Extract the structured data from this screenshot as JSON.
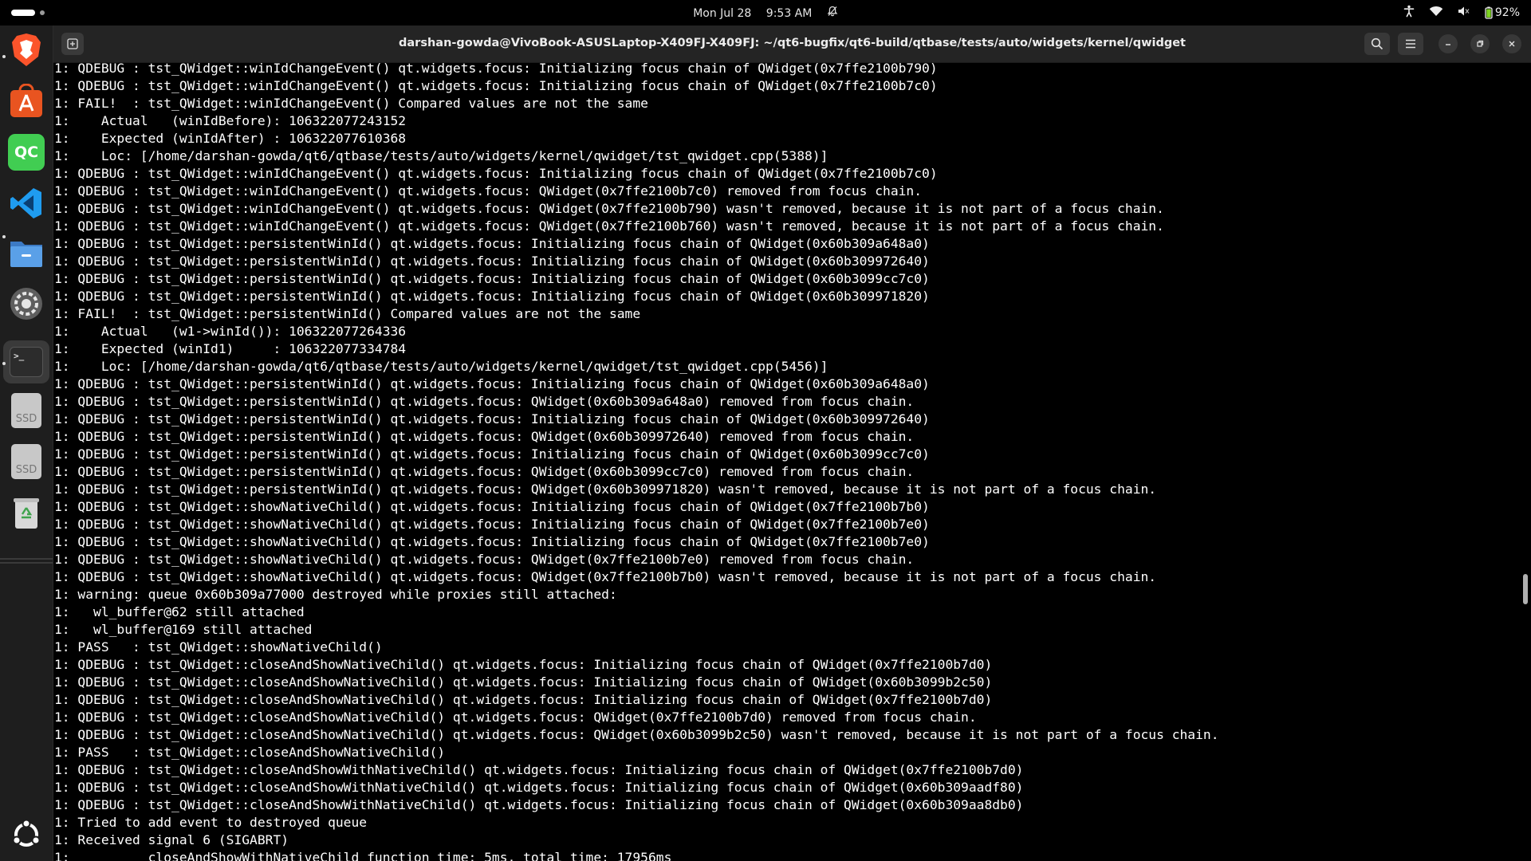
{
  "topbar": {
    "date": "Mon Jul 28",
    "time": "9:53 AM",
    "battery": "92%"
  },
  "dock": {
    "apps": [
      {
        "name": "brave-icon",
        "label": ""
      },
      {
        "name": "app-center-icon",
        "label": ""
      },
      {
        "name": "qt-creator-icon",
        "label": "QC"
      },
      {
        "name": "vscode-icon",
        "label": ""
      },
      {
        "name": "files-icon",
        "label": ""
      },
      {
        "name": "settings-icon",
        "label": ""
      },
      {
        "name": "terminal-icon",
        "label": ">_"
      },
      {
        "name": "ssd-drive-icon",
        "label": "SSD"
      },
      {
        "name": "ssd-drive-icon-2",
        "label": "SSD"
      },
      {
        "name": "trash-icon",
        "label": ""
      }
    ]
  },
  "window": {
    "title": "darshan-gowda@VivoBook-ASUSLaptop-X409FJ-X409FJ: ~/qt6-bugfix/qt6-build/qtbase/tests/auto/widgets/kernel/qwidget"
  },
  "terminal": {
    "lines": [
      "1: QDEBUG : tst_QWidget::winIdChangeEvent() qt.widgets.focus: Initializing focus chain of QWidget(0x7ffe2100b790)",
      "1: QDEBUG : tst_QWidget::winIdChangeEvent() qt.widgets.focus: Initializing focus chain of QWidget(0x7ffe2100b7c0)",
      "1: FAIL!  : tst_QWidget::winIdChangeEvent() Compared values are not the same",
      "1:    Actual   (winIdBefore): 106322077243152",
      "1:    Expected (winIdAfter) : 106322077610368",
      "1:    Loc: [/home/darshan-gowda/qt6/qtbase/tests/auto/widgets/kernel/qwidget/tst_qwidget.cpp(5388)]",
      "1: QDEBUG : tst_QWidget::winIdChangeEvent() qt.widgets.focus: Initializing focus chain of QWidget(0x7ffe2100b7c0)",
      "1: QDEBUG : tst_QWidget::winIdChangeEvent() qt.widgets.focus: QWidget(0x7ffe2100b7c0) removed from focus chain.",
      "1: QDEBUG : tst_QWidget::winIdChangeEvent() qt.widgets.focus: QWidget(0x7ffe2100b790) wasn't removed, because it is not part of a focus chain.",
      "1: QDEBUG : tst_QWidget::winIdChangeEvent() qt.widgets.focus: QWidget(0x7ffe2100b760) wasn't removed, because it is not part of a focus chain.",
      "1: QDEBUG : tst_QWidget::persistentWinId() qt.widgets.focus: Initializing focus chain of QWidget(0x60b309a648a0)",
      "1: QDEBUG : tst_QWidget::persistentWinId() qt.widgets.focus: Initializing focus chain of QWidget(0x60b309972640)",
      "1: QDEBUG : tst_QWidget::persistentWinId() qt.widgets.focus: Initializing focus chain of QWidget(0x60b3099cc7c0)",
      "1: QDEBUG : tst_QWidget::persistentWinId() qt.widgets.focus: Initializing focus chain of QWidget(0x60b309971820)",
      "1: FAIL!  : tst_QWidget::persistentWinId() Compared values are not the same",
      "1:    Actual   (w1->winId()): 106322077264336",
      "1:    Expected (winId1)     : 106322077334784",
      "1:    Loc: [/home/darshan-gowda/qt6/qtbase/tests/auto/widgets/kernel/qwidget/tst_qwidget.cpp(5456)]",
      "1: QDEBUG : tst_QWidget::persistentWinId() qt.widgets.focus: Initializing focus chain of QWidget(0x60b309a648a0)",
      "1: QDEBUG : tst_QWidget::persistentWinId() qt.widgets.focus: QWidget(0x60b309a648a0) removed from focus chain.",
      "1: QDEBUG : tst_QWidget::persistentWinId() qt.widgets.focus: Initializing focus chain of QWidget(0x60b309972640)",
      "1: QDEBUG : tst_QWidget::persistentWinId() qt.widgets.focus: QWidget(0x60b309972640) removed from focus chain.",
      "1: QDEBUG : tst_QWidget::persistentWinId() qt.widgets.focus: Initializing focus chain of QWidget(0x60b3099cc7c0)",
      "1: QDEBUG : tst_QWidget::persistentWinId() qt.widgets.focus: QWidget(0x60b3099cc7c0) removed from focus chain.",
      "1: QDEBUG : tst_QWidget::persistentWinId() qt.widgets.focus: QWidget(0x60b309971820) wasn't removed, because it is not part of a focus chain.",
      "1: QDEBUG : tst_QWidget::showNativeChild() qt.widgets.focus: Initializing focus chain of QWidget(0x7ffe2100b7b0)",
      "1: QDEBUG : tst_QWidget::showNativeChild() qt.widgets.focus: Initializing focus chain of QWidget(0x7ffe2100b7e0)",
      "1: QDEBUG : tst_QWidget::showNativeChild() qt.widgets.focus: Initializing focus chain of QWidget(0x7ffe2100b7e0)",
      "1: QDEBUG : tst_QWidget::showNativeChild() qt.widgets.focus: QWidget(0x7ffe2100b7e0) removed from focus chain.",
      "1: QDEBUG : tst_QWidget::showNativeChild() qt.widgets.focus: QWidget(0x7ffe2100b7b0) wasn't removed, because it is not part of a focus chain.",
      "1: warning: queue 0x60b309a77000 destroyed while proxies still attached:",
      "1:   wl_buffer@62 still attached",
      "1:   wl_buffer@169 still attached",
      "1: PASS   : tst_QWidget::showNativeChild()",
      "1: QDEBUG : tst_QWidget::closeAndShowNativeChild() qt.widgets.focus: Initializing focus chain of QWidget(0x7ffe2100b7d0)",
      "1: QDEBUG : tst_QWidget::closeAndShowNativeChild() qt.widgets.focus: Initializing focus chain of QWidget(0x60b3099b2c50)",
      "1: QDEBUG : tst_QWidget::closeAndShowNativeChild() qt.widgets.focus: Initializing focus chain of QWidget(0x7ffe2100b7d0)",
      "1: QDEBUG : tst_QWidget::closeAndShowNativeChild() qt.widgets.focus: QWidget(0x7ffe2100b7d0) removed from focus chain.",
      "1: QDEBUG : tst_QWidget::closeAndShowNativeChild() qt.widgets.focus: QWidget(0x60b3099b2c50) wasn't removed, because it is not part of a focus chain.",
      "1: PASS   : tst_QWidget::closeAndShowNativeChild()",
      "1: QDEBUG : tst_QWidget::closeAndShowWithNativeChild() qt.widgets.focus: Initializing focus chain of QWidget(0x7ffe2100b7d0)",
      "1: QDEBUG : tst_QWidget::closeAndShowWithNativeChild() qt.widgets.focus: Initializing focus chain of QWidget(0x60b309aadf80)",
      "1: QDEBUG : tst_QWidget::closeAndShowWithNativeChild() qt.widgets.focus: Initializing focus chain of QWidget(0x60b309aa8db0)",
      "1: Tried to add event to destroyed queue",
      "1: Received signal 6 (SIGABRT)",
      "1:          closeAndShowWithNativeChild function time: 5ms, total time: 17956ms"
    ]
  },
  "colors": {
    "terminal_bg": "#000000",
    "terminal_fg": "#ffffff",
    "titlebar_bg": "#242424",
    "dock_bg": "#1e1e1e"
  }
}
